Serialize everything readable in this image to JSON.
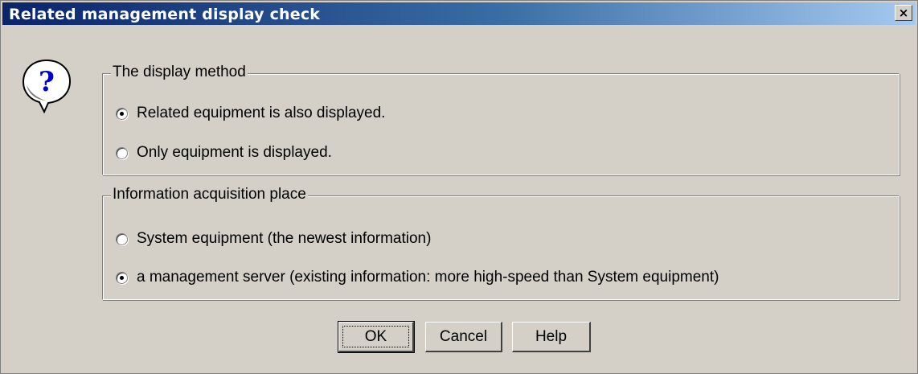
{
  "window": {
    "title": "Related management display check",
    "close_glyph": "×"
  },
  "icon": "question-icon",
  "display_method": {
    "legend": "The display method",
    "options": [
      {
        "label": "Related equipment is also displayed.",
        "checked": true
      },
      {
        "label": "Only equipment is displayed.",
        "checked": false
      }
    ]
  },
  "acquisition_place": {
    "legend": "Information acquisition place",
    "options": [
      {
        "label": "System equipment (the newest information)",
        "checked": false
      },
      {
        "label": "a management server (existing information: more high-speed than System equipment)",
        "checked": true
      }
    ]
  },
  "buttons": {
    "ok": "OK",
    "cancel": "Cancel",
    "help": "Help"
  },
  "colors": {
    "titlebar_start": "#0a246a",
    "titlebar_end": "#a6caf0",
    "dialog_bg": "#d4d0c8"
  }
}
